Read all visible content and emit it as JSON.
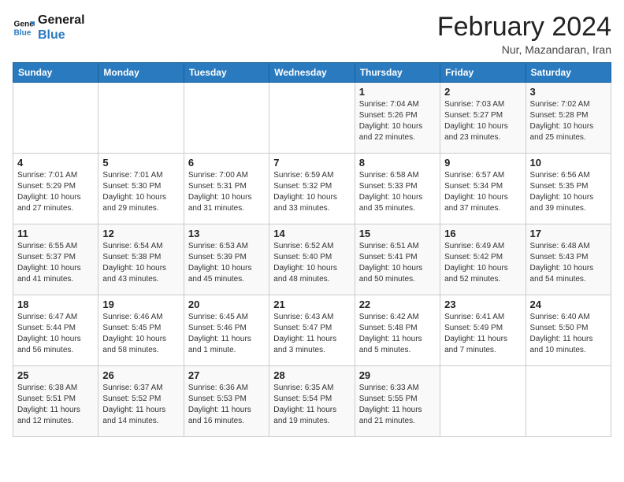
{
  "header": {
    "logo_line1": "General",
    "logo_line2": "Blue",
    "month": "February 2024",
    "location": "Nur, Mazandaran, Iran"
  },
  "days_of_week": [
    "Sunday",
    "Monday",
    "Tuesday",
    "Wednesday",
    "Thursday",
    "Friday",
    "Saturday"
  ],
  "weeks": [
    [
      {
        "day": "",
        "info": ""
      },
      {
        "day": "",
        "info": ""
      },
      {
        "day": "",
        "info": ""
      },
      {
        "day": "",
        "info": ""
      },
      {
        "day": "1",
        "info": "Sunrise: 7:04 AM\nSunset: 5:26 PM\nDaylight: 10 hours\nand 22 minutes."
      },
      {
        "day": "2",
        "info": "Sunrise: 7:03 AM\nSunset: 5:27 PM\nDaylight: 10 hours\nand 23 minutes."
      },
      {
        "day": "3",
        "info": "Sunrise: 7:02 AM\nSunset: 5:28 PM\nDaylight: 10 hours\nand 25 minutes."
      }
    ],
    [
      {
        "day": "4",
        "info": "Sunrise: 7:01 AM\nSunset: 5:29 PM\nDaylight: 10 hours\nand 27 minutes."
      },
      {
        "day": "5",
        "info": "Sunrise: 7:01 AM\nSunset: 5:30 PM\nDaylight: 10 hours\nand 29 minutes."
      },
      {
        "day": "6",
        "info": "Sunrise: 7:00 AM\nSunset: 5:31 PM\nDaylight: 10 hours\nand 31 minutes."
      },
      {
        "day": "7",
        "info": "Sunrise: 6:59 AM\nSunset: 5:32 PM\nDaylight: 10 hours\nand 33 minutes."
      },
      {
        "day": "8",
        "info": "Sunrise: 6:58 AM\nSunset: 5:33 PM\nDaylight: 10 hours\nand 35 minutes."
      },
      {
        "day": "9",
        "info": "Sunrise: 6:57 AM\nSunset: 5:34 PM\nDaylight: 10 hours\nand 37 minutes."
      },
      {
        "day": "10",
        "info": "Sunrise: 6:56 AM\nSunset: 5:35 PM\nDaylight: 10 hours\nand 39 minutes."
      }
    ],
    [
      {
        "day": "11",
        "info": "Sunrise: 6:55 AM\nSunset: 5:37 PM\nDaylight: 10 hours\nand 41 minutes."
      },
      {
        "day": "12",
        "info": "Sunrise: 6:54 AM\nSunset: 5:38 PM\nDaylight: 10 hours\nand 43 minutes."
      },
      {
        "day": "13",
        "info": "Sunrise: 6:53 AM\nSunset: 5:39 PM\nDaylight: 10 hours\nand 45 minutes."
      },
      {
        "day": "14",
        "info": "Sunrise: 6:52 AM\nSunset: 5:40 PM\nDaylight: 10 hours\nand 48 minutes."
      },
      {
        "day": "15",
        "info": "Sunrise: 6:51 AM\nSunset: 5:41 PM\nDaylight: 10 hours\nand 50 minutes."
      },
      {
        "day": "16",
        "info": "Sunrise: 6:49 AM\nSunset: 5:42 PM\nDaylight: 10 hours\nand 52 minutes."
      },
      {
        "day": "17",
        "info": "Sunrise: 6:48 AM\nSunset: 5:43 PM\nDaylight: 10 hours\nand 54 minutes."
      }
    ],
    [
      {
        "day": "18",
        "info": "Sunrise: 6:47 AM\nSunset: 5:44 PM\nDaylight: 10 hours\nand 56 minutes."
      },
      {
        "day": "19",
        "info": "Sunrise: 6:46 AM\nSunset: 5:45 PM\nDaylight: 10 hours\nand 58 minutes."
      },
      {
        "day": "20",
        "info": "Sunrise: 6:45 AM\nSunset: 5:46 PM\nDaylight: 11 hours\nand 1 minute."
      },
      {
        "day": "21",
        "info": "Sunrise: 6:43 AM\nSunset: 5:47 PM\nDaylight: 11 hours\nand 3 minutes."
      },
      {
        "day": "22",
        "info": "Sunrise: 6:42 AM\nSunset: 5:48 PM\nDaylight: 11 hours\nand 5 minutes."
      },
      {
        "day": "23",
        "info": "Sunrise: 6:41 AM\nSunset: 5:49 PM\nDaylight: 11 hours\nand 7 minutes."
      },
      {
        "day": "24",
        "info": "Sunrise: 6:40 AM\nSunset: 5:50 PM\nDaylight: 11 hours\nand 10 minutes."
      }
    ],
    [
      {
        "day": "25",
        "info": "Sunrise: 6:38 AM\nSunset: 5:51 PM\nDaylight: 11 hours\nand 12 minutes."
      },
      {
        "day": "26",
        "info": "Sunrise: 6:37 AM\nSunset: 5:52 PM\nDaylight: 11 hours\nand 14 minutes."
      },
      {
        "day": "27",
        "info": "Sunrise: 6:36 AM\nSunset: 5:53 PM\nDaylight: 11 hours\nand 16 minutes."
      },
      {
        "day": "28",
        "info": "Sunrise: 6:35 AM\nSunset: 5:54 PM\nDaylight: 11 hours\nand 19 minutes."
      },
      {
        "day": "29",
        "info": "Sunrise: 6:33 AM\nSunset: 5:55 PM\nDaylight: 11 hours\nand 21 minutes."
      },
      {
        "day": "",
        "info": ""
      },
      {
        "day": "",
        "info": ""
      }
    ]
  ]
}
